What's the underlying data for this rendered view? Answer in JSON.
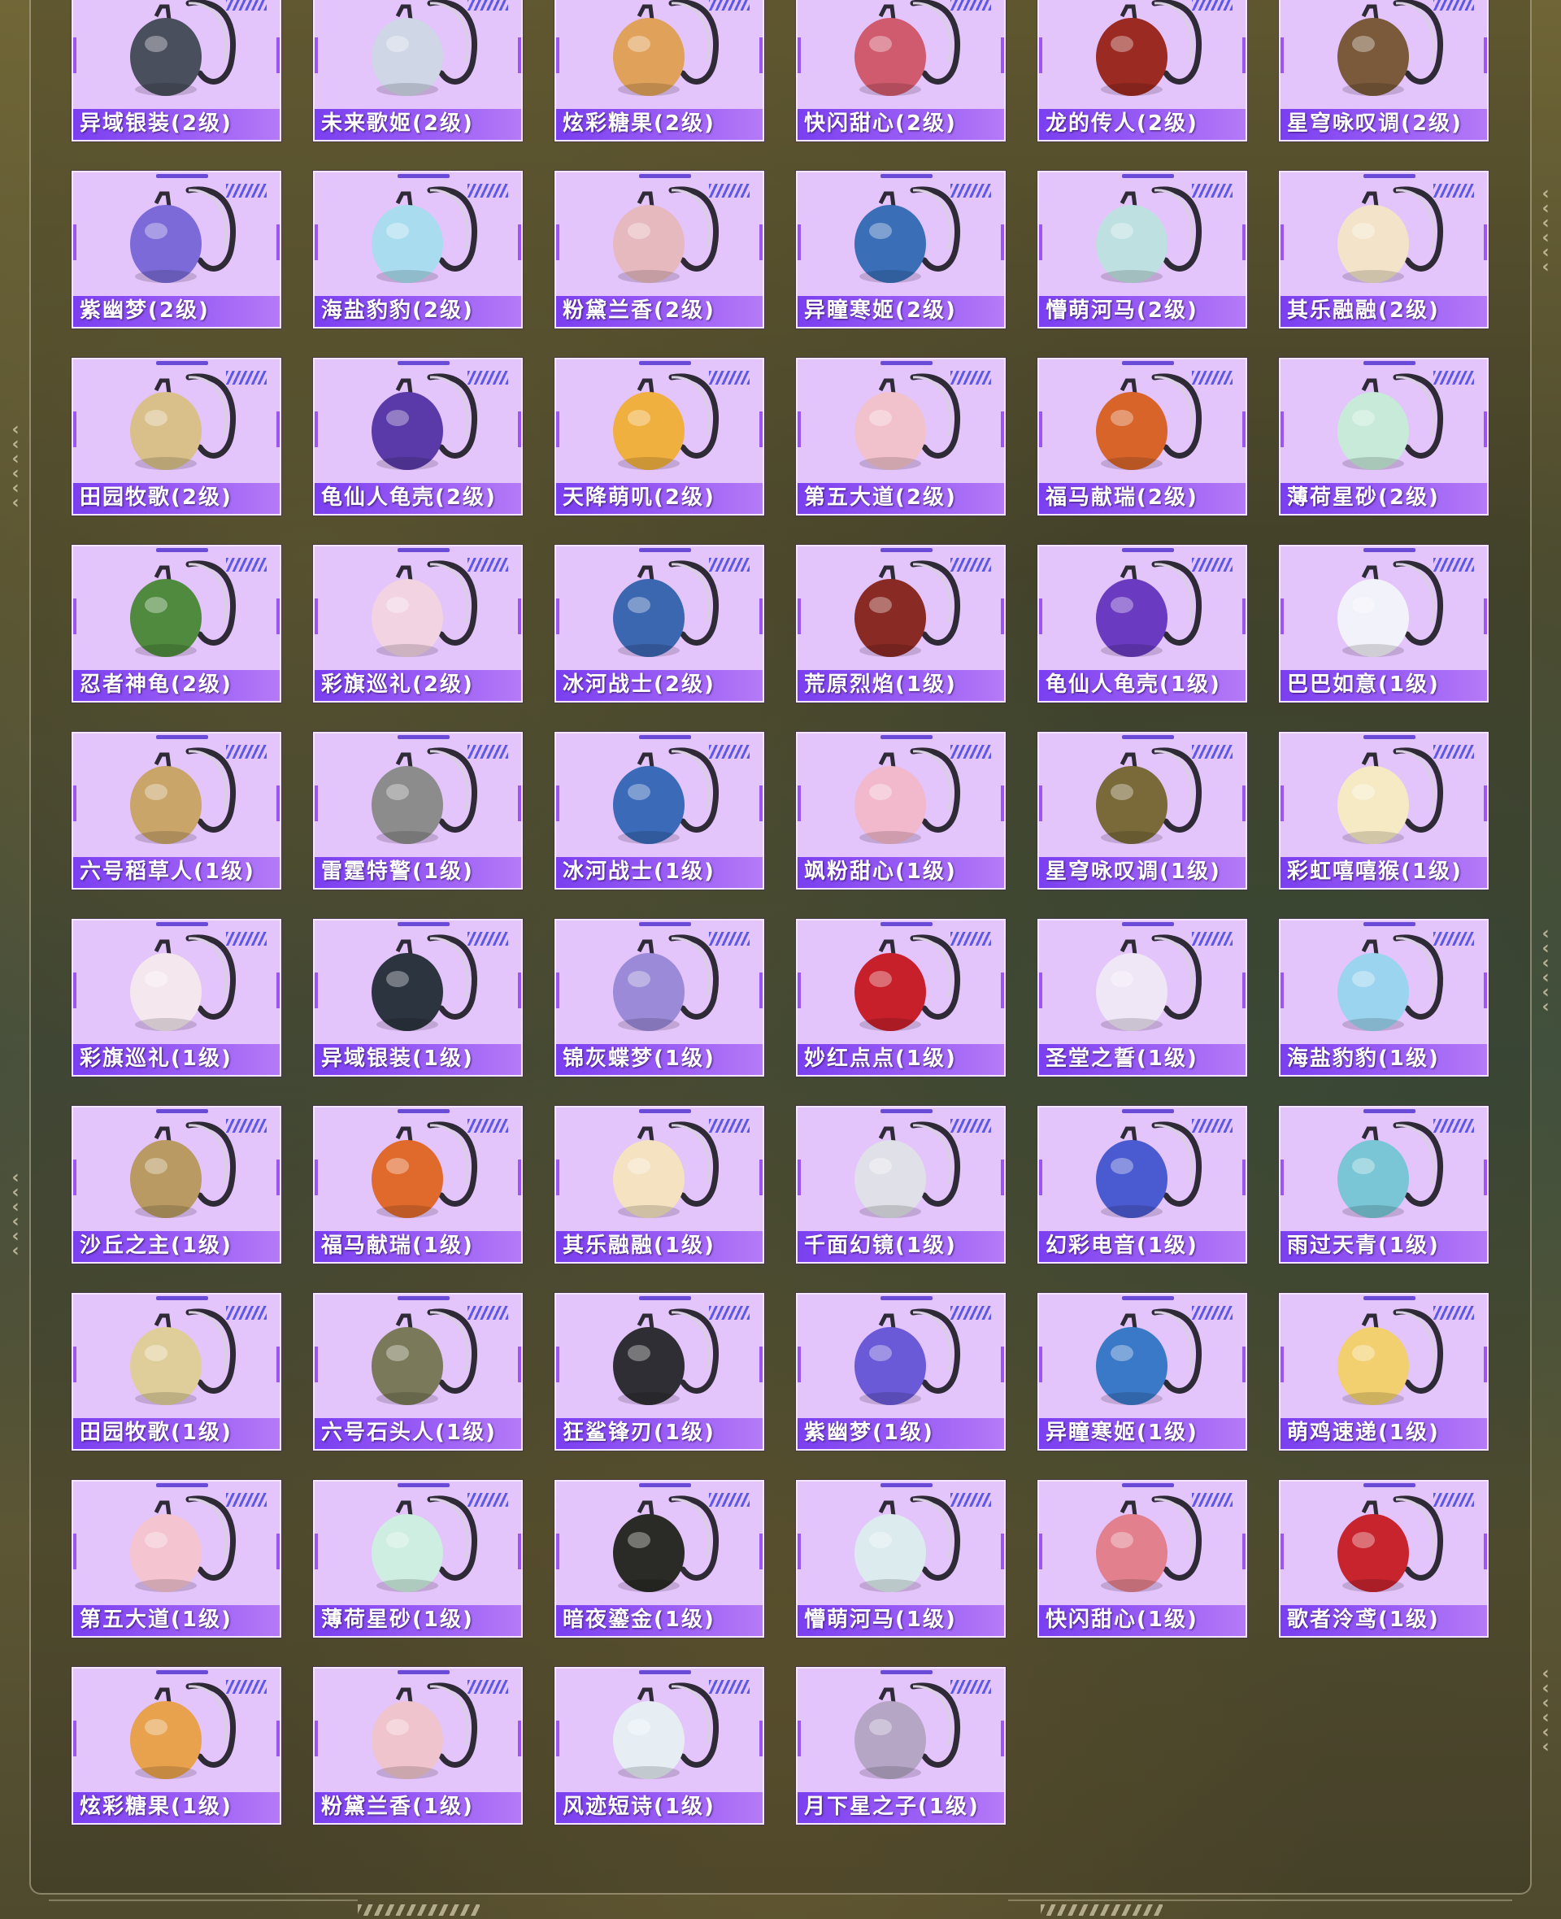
{
  "colors": {
    "card_bg": "#e3c4fb",
    "label_bar": "#8a4ef2",
    "accent_stripes": "#5d58e6"
  },
  "items": [
    {
      "name": "异域银装(2级)",
      "color": "#4a4f5e",
      "icon": "backpack-icon"
    },
    {
      "name": "未来歌姬(2级)",
      "color": "#cfd6e6",
      "icon": "backpack-icon"
    },
    {
      "name": "炫彩糖果(2级)",
      "color": "#e0a15a",
      "icon": "backpack-icon"
    },
    {
      "name": "快闪甜心(2级)",
      "color": "#d05a6e",
      "icon": "backpack-icon"
    },
    {
      "name": "龙的传人(2级)",
      "color": "#9a2a22",
      "icon": "backpack-icon"
    },
    {
      "name": "星穹咏叹调(2级)",
      "color": "#7a5a3a",
      "icon": "backpack-icon"
    },
    {
      "name": "紫幽梦(2级)",
      "color": "#7b6ad8",
      "icon": "backpack-icon"
    },
    {
      "name": "海盐豹豹(2级)",
      "color": "#a9dcef",
      "icon": "backpack-icon"
    },
    {
      "name": "粉黛兰香(2级)",
      "color": "#e6b9be",
      "icon": "backpack-icon"
    },
    {
      "name": "异瞳寒姬(2级)",
      "color": "#3a6fb8",
      "icon": "backpack-icon"
    },
    {
      "name": "懵萌河马(2级)",
      "color": "#bfe0e0",
      "icon": "backpack-icon"
    },
    {
      "name": "其乐融融(2级)",
      "color": "#f3e3c8",
      "icon": "backpack-icon"
    },
    {
      "name": "田园牧歌(2级)",
      "color": "#d9c08a",
      "icon": "backpack-icon"
    },
    {
      "name": "龟仙人龟壳(2级)",
      "color": "#5a3aa8",
      "icon": "backpack-icon"
    },
    {
      "name": "天降萌叽(2级)",
      "color": "#f0b040",
      "icon": "backpack-icon"
    },
    {
      "name": "第五大道(2级)",
      "color": "#f2c2cc",
      "icon": "backpack-icon"
    },
    {
      "name": "福马献瑞(2级)",
      "color": "#d8642a",
      "icon": "backpack-icon"
    },
    {
      "name": "薄荷星砂(2级)",
      "color": "#c7ead9",
      "icon": "backpack-icon"
    },
    {
      "name": "忍者神龟(2级)",
      "color": "#4f8a3e",
      "icon": "backpack-icon"
    },
    {
      "name": "彩旗巡礼(2级)",
      "color": "#f1d3e2",
      "icon": "backpack-icon"
    },
    {
      "name": "冰河战士(2级)",
      "color": "#3b66b0",
      "icon": "backpack-icon"
    },
    {
      "name": "荒原烈焰(1级)",
      "color": "#8a2a24",
      "icon": "backpack-icon"
    },
    {
      "name": "龟仙人龟壳(1级)",
      "color": "#6a3ac0",
      "icon": "backpack-icon"
    },
    {
      "name": "巴巴如意(1级)",
      "color": "#f2f2fa",
      "icon": "backpack-icon"
    },
    {
      "name": "六号稻草人(1级)",
      "color": "#c9a56a",
      "icon": "backpack-icon"
    },
    {
      "name": "雷霆特警(1级)",
      "color": "#8c8c8c",
      "icon": "backpack-icon"
    },
    {
      "name": "冰河战士(1级)",
      "color": "#3a6ab8",
      "icon": "backpack-icon"
    },
    {
      "name": "飒粉甜心(1级)",
      "color": "#f2b8cc",
      "icon": "backpack-icon"
    },
    {
      "name": "星穹咏叹调(1级)",
      "color": "#7a6a3a",
      "icon": "backpack-icon"
    },
    {
      "name": "彩虹嘻嘻猴(1级)",
      "color": "#f6eac4",
      "icon": "backpack-icon"
    },
    {
      "name": "彩旗巡礼(1级)",
      "color": "#f4e8ee",
      "icon": "backpack-icon"
    },
    {
      "name": "异域银装(1级)",
      "color": "#2c3440",
      "icon": "backpack-icon"
    },
    {
      "name": "锦灰蝶梦(1级)",
      "color": "#9a8ad8",
      "icon": "backpack-icon"
    },
    {
      "name": "妙红点点(1级)",
      "color": "#c8202a",
      "icon": "backpack-icon"
    },
    {
      "name": "圣堂之誓(1级)",
      "color": "#efe6f6",
      "icon": "backpack-icon"
    },
    {
      "name": "海盐豹豹(1级)",
      "color": "#9ad4ef",
      "icon": "backpack-icon"
    },
    {
      "name": "沙丘之主(1级)",
      "color": "#b89a62",
      "icon": "backpack-icon"
    },
    {
      "name": "福马献瑞(1级)",
      "color": "#e06a2c",
      "icon": "backpack-icon"
    },
    {
      "name": "其乐融融(1级)",
      "color": "#f4e2c0",
      "icon": "backpack-icon"
    },
    {
      "name": "千面幻镜(1级)",
      "color": "#e0e0e8",
      "icon": "backpack-icon"
    },
    {
      "name": "幻彩电音(1级)",
      "color": "#4a5ad0",
      "icon": "backpack-icon"
    },
    {
      "name": "雨过天青(1级)",
      "color": "#7ac6d6",
      "icon": "backpack-icon"
    },
    {
      "name": "田园牧歌(1级)",
      "color": "#e0ce9a",
      "icon": "backpack-icon"
    },
    {
      "name": "六号石头人(1级)",
      "color": "#7a7a5a",
      "icon": "backpack-icon"
    },
    {
      "name": "狂鲨锋刃(1级)",
      "color": "#2e2e34",
      "icon": "backpack-icon"
    },
    {
      "name": "紫幽梦(1级)",
      "color": "#6a5ad8",
      "icon": "backpack-icon"
    },
    {
      "name": "异瞳寒姬(1级)",
      "color": "#3a78c8",
      "icon": "backpack-icon"
    },
    {
      "name": "萌鸡速递(1级)",
      "color": "#f2d070",
      "icon": "backpack-icon"
    },
    {
      "name": "第五大道(1级)",
      "color": "#f4c4d0",
      "icon": "backpack-icon"
    },
    {
      "name": "薄荷星砂(1级)",
      "color": "#cdeee0",
      "icon": "backpack-icon"
    },
    {
      "name": "暗夜鎏金(1级)",
      "color": "#2a2a26",
      "icon": "backpack-icon"
    },
    {
      "name": "懵萌河马(1级)",
      "color": "#dcecee",
      "icon": "backpack-icon"
    },
    {
      "name": "快闪甜心(1级)",
      "color": "#e2808e",
      "icon": "backpack-icon"
    },
    {
      "name": "歌者泠鸢(1级)",
      "color": "#c8242e",
      "icon": "backpack-icon"
    },
    {
      "name": "炫彩糖果(1级)",
      "color": "#e8a24e",
      "icon": "backpack-icon"
    },
    {
      "name": "粉黛兰香(1级)",
      "color": "#efc4cc",
      "icon": "backpack-icon"
    },
    {
      "name": "风迹短诗(1级)",
      "color": "#e6eef4",
      "icon": "backpack-icon"
    },
    {
      "name": "月下星之子(1级)",
      "color": "#b6a6c6",
      "icon": "backpack-icon"
    }
  ]
}
